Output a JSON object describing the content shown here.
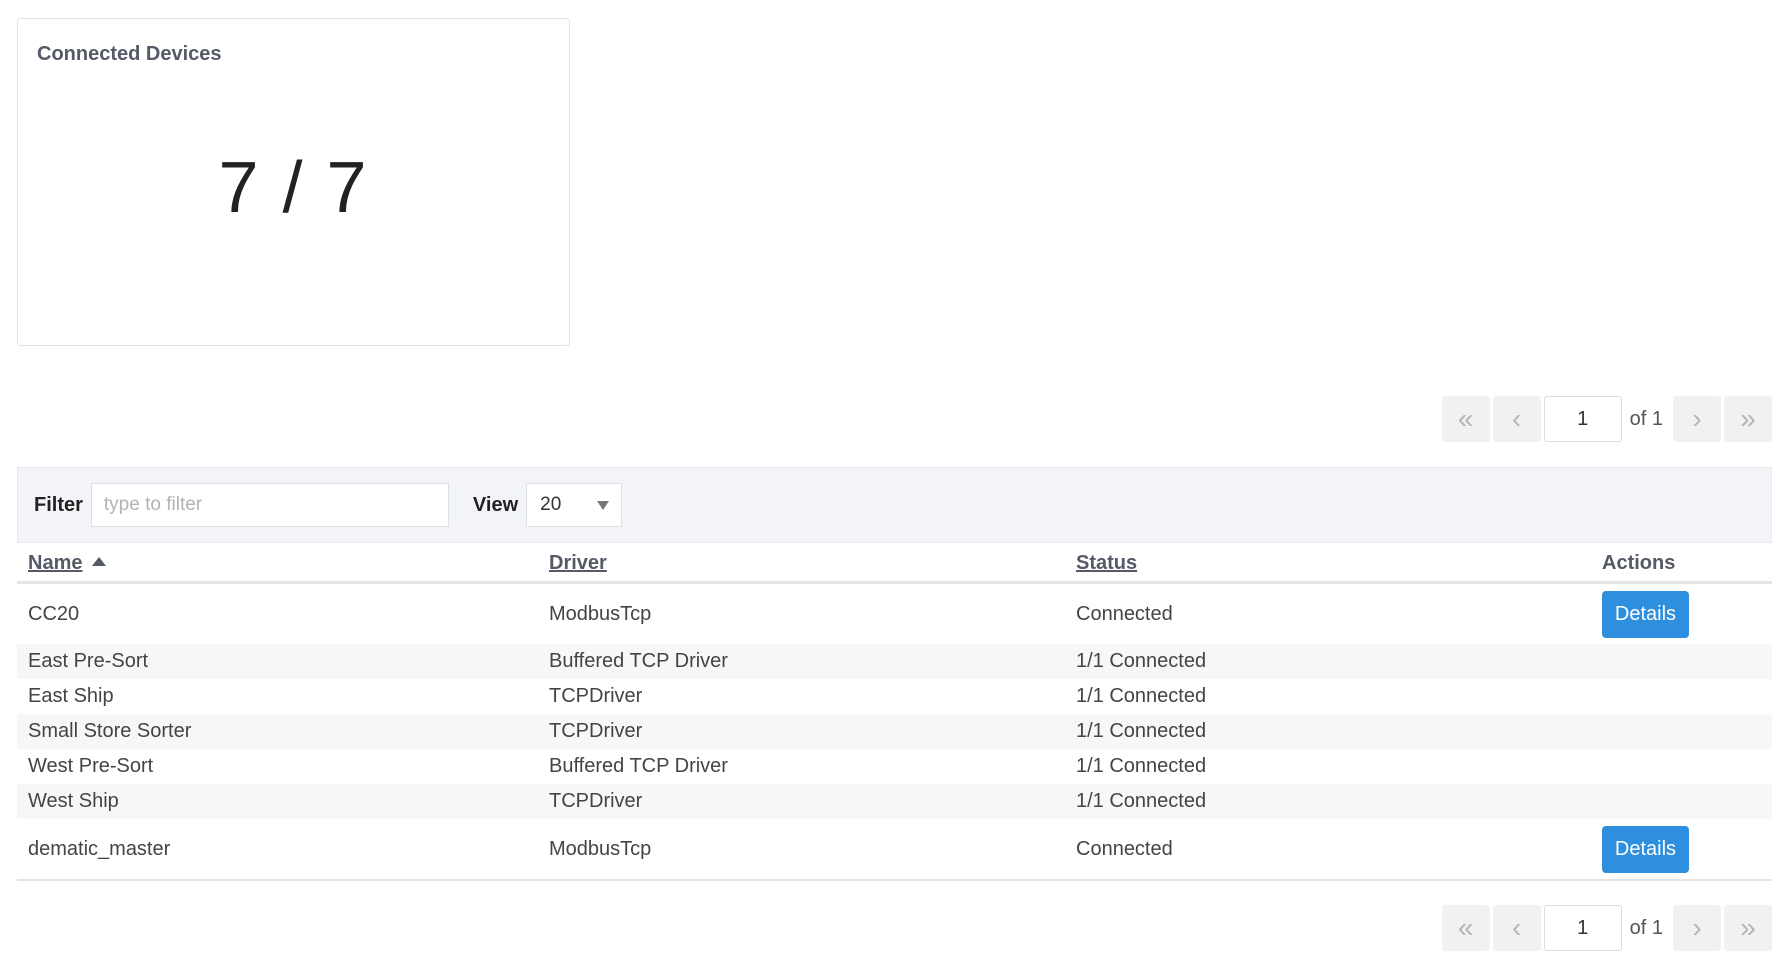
{
  "card": {
    "title": "Connected Devices",
    "value": "7 / 7"
  },
  "pagination": {
    "first": "«",
    "prev": "‹",
    "next": "›",
    "last": "»",
    "page": "1",
    "of_label": "of 1"
  },
  "filter": {
    "label": "Filter",
    "placeholder": "type to filter",
    "view_label": "View",
    "view_value": "20"
  },
  "table": {
    "headers": {
      "name": "Name",
      "driver": "Driver",
      "status": "Status",
      "actions": "Actions"
    },
    "details_label": "Details",
    "rows": [
      {
        "name": "CC20",
        "driver": "ModbusTcp",
        "status": "Connected"
      },
      {
        "name": "East Pre-Sort",
        "driver": "Buffered TCP Driver",
        "status": "1/1 Connected"
      },
      {
        "name": "East Ship",
        "driver": "TCPDriver",
        "status": "1/1 Connected"
      },
      {
        "name": "Small Store Sorter",
        "driver": "TCPDriver",
        "status": "1/1 Connected"
      },
      {
        "name": "West Pre-Sort",
        "driver": "Buffered TCP Driver",
        "status": "1/1 Connected"
      },
      {
        "name": "West Ship",
        "driver": "TCPDriver",
        "status": "1/1 Connected"
      },
      {
        "name": "dematic_master",
        "driver": "ModbusTcp",
        "status": "Connected"
      }
    ]
  }
}
